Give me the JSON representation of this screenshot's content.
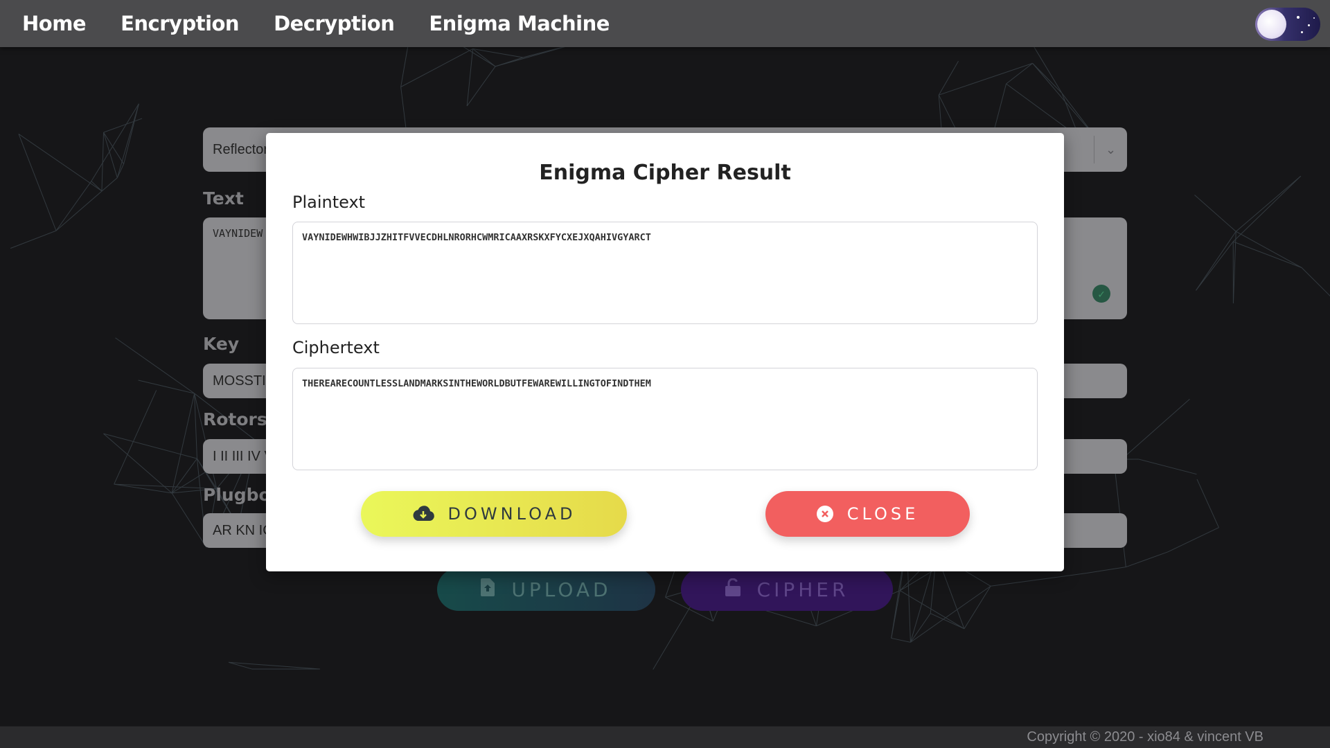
{
  "navbar": {
    "items": [
      "Home",
      "Encryption",
      "Decryption",
      "Enigma Machine"
    ],
    "theme_toggle": "moon-night-toggle"
  },
  "form": {
    "reflector_value": "Reflector",
    "text_label": "Text",
    "text_value": "VAYNIDEW",
    "key_label": "Key",
    "key_value": "MOSSTI",
    "rotors_label": "Rotors",
    "rotors_value": "I II III IV V",
    "plugboard_label": "Plugboa",
    "plugboard_value": "AR KN IC",
    "upload_label": "UPLOAD",
    "cipher_label": "CIPHER"
  },
  "modal": {
    "title": "Enigma Cipher Result",
    "plaintext_label": "Plaintext",
    "plaintext_value": "VAYNIDEWHWIBJJZHITFVVECDHLNRORHCWMRICAAXRSKXFYCXEJXQAHIVGYARCT",
    "ciphertext_label": "Ciphertext",
    "ciphertext_value": "THEREARECOUNTLESSLANDMARKSINTHEWORLDBUTFEWAREWILLINGTOFINDTHEM",
    "download_label": "DOWNLOAD",
    "close_label": "CLOSE"
  },
  "footer": {
    "copyright": "Copyright © 2020 - xio84 & vincent VB"
  },
  "icons": {
    "download": "cloud-download-icon",
    "close": "times-circle-icon",
    "upload": "file-upload-icon",
    "cipher": "unlock-icon"
  },
  "colors": {
    "navbar": "#4b4b4d",
    "background": "#1c1c1e",
    "download_button": "#e8ef55",
    "close_button": "#f25f5f",
    "upload_button": "#1d5b5a",
    "cipher_button": "#3c1a6e"
  }
}
